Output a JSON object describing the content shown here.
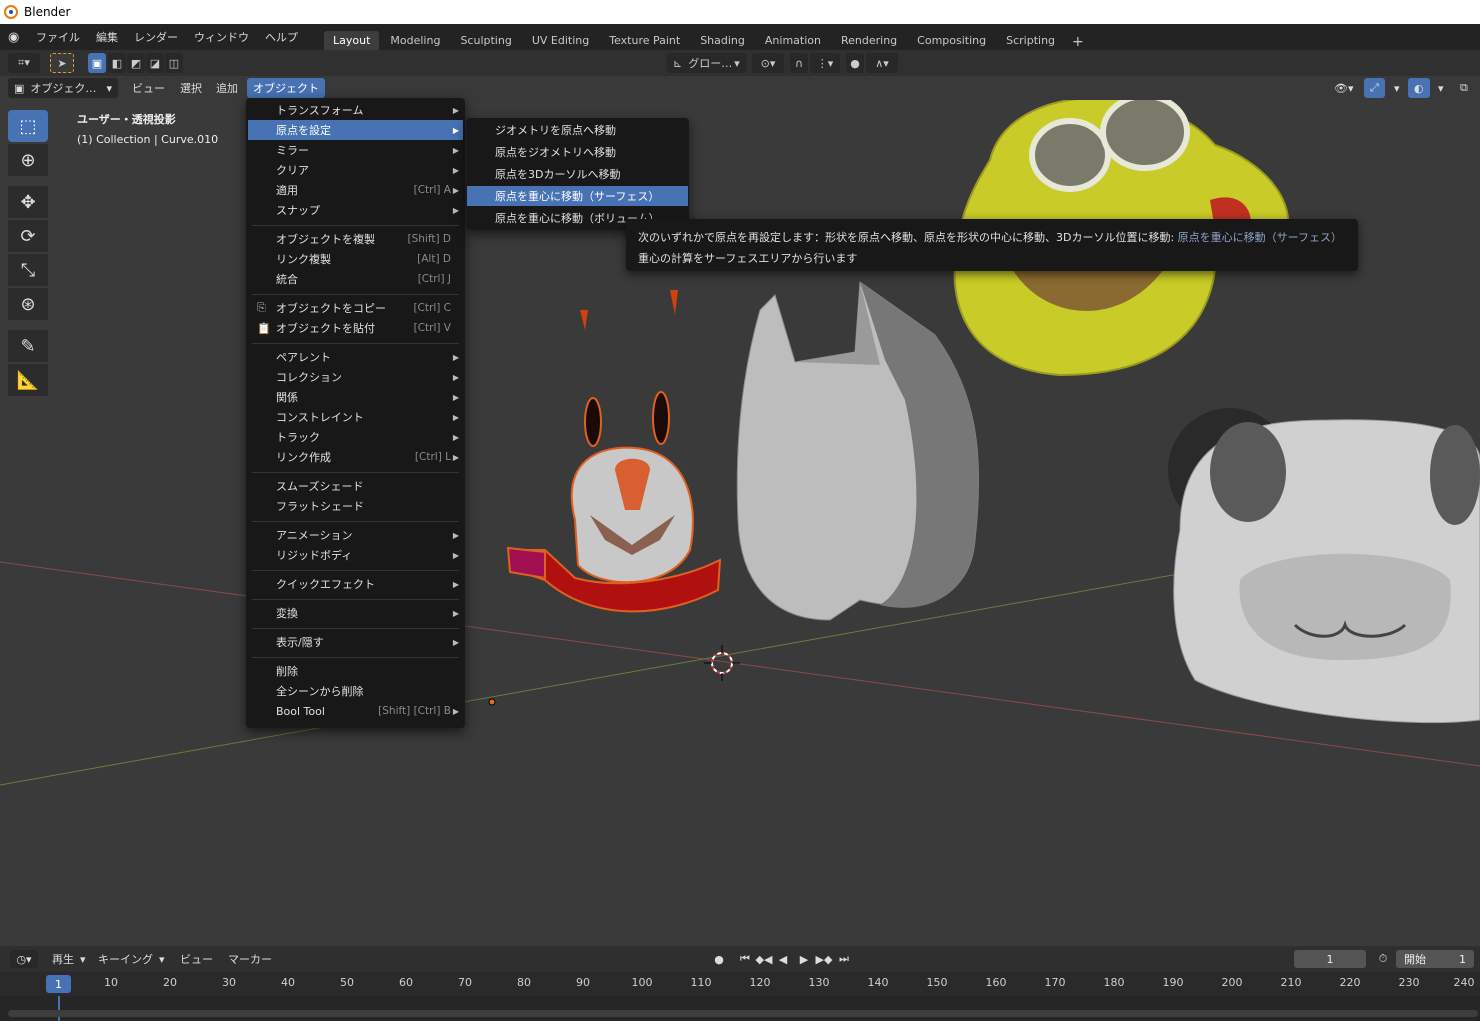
{
  "title_bar": {
    "title": "Blender"
  },
  "top_menu": [
    "ファイル",
    "編集",
    "レンダー",
    "ウィンドウ",
    "ヘルプ"
  ],
  "workspace_tabs": [
    "Layout",
    "Modeling",
    "Sculpting",
    "UV Editing",
    "Texture Paint",
    "Shading",
    "Animation",
    "Rendering",
    "Compositing",
    "Scripting"
  ],
  "workspace_add": "+",
  "toolbar_header": {
    "transform_orientation": "グロー…"
  },
  "viewport_header": {
    "mode": "オブジェク…",
    "menus": [
      "ビュー",
      "選択",
      "追加",
      "オブジェクト"
    ]
  },
  "viewport_info": {
    "view_name": "ユーザー・透視投影",
    "collection": "(1) Collection | Curve.010"
  },
  "object_menu": {
    "items": [
      {
        "label": "トランスフォーム",
        "shortcut": "",
        "submenu": true
      },
      {
        "label": "原点を設定",
        "shortcut": "",
        "submenu": true,
        "highlighted": true
      },
      {
        "label": "ミラー",
        "shortcut": "",
        "submenu": true
      },
      {
        "label": "クリア",
        "shortcut": "",
        "submenu": true
      },
      {
        "label": "適用",
        "shortcut": "[Ctrl] A",
        "submenu": true
      },
      {
        "label": "スナップ",
        "shortcut": "",
        "submenu": true
      },
      {
        "label": "オブジェクトを複製",
        "shortcut": "[Shift] D",
        "submenu": false
      },
      {
        "label": "リンク複製",
        "shortcut": "[Alt] D",
        "submenu": false
      },
      {
        "label": "統合",
        "shortcut": "[Ctrl] J",
        "submenu": false
      },
      {
        "label": "オブジェクトをコピー",
        "shortcut": "[Ctrl] C",
        "submenu": false
      },
      {
        "label": "オブジェクトを貼付",
        "shortcut": "[Ctrl] V",
        "submenu": false
      },
      {
        "label": "ペアレント",
        "shortcut": "",
        "submenu": true
      },
      {
        "label": "コレクション",
        "shortcut": "",
        "submenu": true
      },
      {
        "label": "関係",
        "shortcut": "",
        "submenu": true
      },
      {
        "label": "コンストレイント",
        "shortcut": "",
        "submenu": true
      },
      {
        "label": "トラック",
        "shortcut": "",
        "submenu": true
      },
      {
        "label": "リンク作成",
        "shortcut": "[Ctrl] L",
        "submenu": true
      },
      {
        "label": "スムーズシェード",
        "shortcut": "",
        "submenu": false
      },
      {
        "label": "フラットシェード",
        "shortcut": "",
        "submenu": false
      },
      {
        "label": "アニメーション",
        "shortcut": "",
        "submenu": true
      },
      {
        "label": "リジッドボディ",
        "shortcut": "",
        "submenu": true
      },
      {
        "label": "クイックエフェクト",
        "shortcut": "",
        "submenu": true
      },
      {
        "label": "変換",
        "shortcut": "",
        "submenu": true
      },
      {
        "label": "表示/隠す",
        "shortcut": "",
        "submenu": true
      },
      {
        "label": "削除",
        "shortcut": "",
        "submenu": false
      },
      {
        "label": "全シーンから削除",
        "shortcut": "",
        "submenu": false
      },
      {
        "label": "Bool Tool",
        "shortcut": "[Shift] [Ctrl] B",
        "submenu": true
      }
    ]
  },
  "origin_submenu": {
    "items": [
      {
        "label": "ジオメトリを原点へ移動",
        "highlighted": false
      },
      {
        "label": "原点をジオメトリへ移動",
        "highlighted": false
      },
      {
        "label": "原点を3Dカーソルへ移動",
        "highlighted": false
      },
      {
        "label": "原点を重心に移動（サーフェス）",
        "highlighted": true
      },
      {
        "label": "原点を重心に移動（ボリューム）",
        "highlighted": false
      }
    ]
  },
  "tooltip": {
    "line1": "次のいずれかで原点を再設定します：形状を原点へ移動、原点を形状の中心に移動、3Dカーソル位置に移動:",
    "line1_highlight": "原点を重心に移動（サーフェス）",
    "line2": "重心の計算をサーフェスエリアから行います"
  },
  "timeline": {
    "menus": [
      "再生",
      "キーイング",
      "ビュー",
      "マーカー"
    ],
    "current_frame": "1",
    "start_label": "開始",
    "start_value": "1",
    "ticks": [
      "10",
      "20",
      "30",
      "40",
      "50",
      "60",
      "70",
      "80",
      "90",
      "100",
      "110",
      "120",
      "130",
      "140",
      "150",
      "160",
      "170",
      "180",
      "190",
      "200",
      "210",
      "220",
      "230",
      "240"
    ],
    "frame_marker": "1"
  }
}
